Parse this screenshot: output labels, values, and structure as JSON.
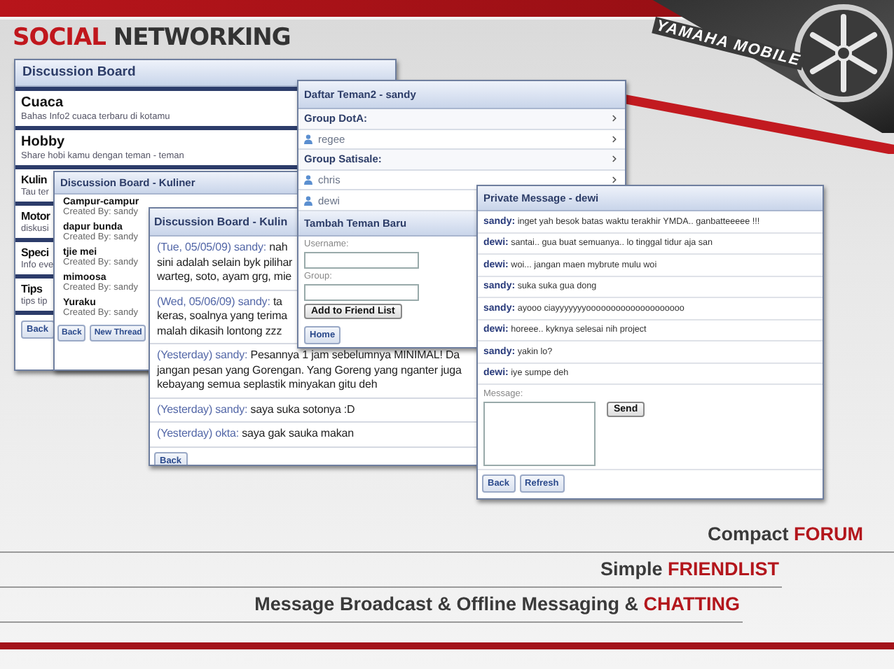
{
  "title": {
    "accent": "SOCIAL",
    "text": "NETWORKING"
  },
  "logo": {
    "text": "YAMAHA MOBILE"
  },
  "discussion_board": {
    "title": "Discussion Board",
    "topics": [
      {
        "name": "Cuaca",
        "description": "Bahas Info2 cuaca terbaru di kotamu"
      },
      {
        "name": "Hobby",
        "description": "Share hobi kamu dengan teman - teman"
      },
      {
        "name": "Kulin",
        "description": "Tau ter"
      },
      {
        "name": "Motor",
        "description": "diskusi"
      },
      {
        "name": "Speci",
        "description": "Info eve"
      },
      {
        "name": "Tips",
        "description": "tips tip"
      }
    ],
    "buttons": [
      "Back"
    ]
  },
  "kuliner_threads": {
    "title": "Discussion Board - Kuliner",
    "threads": [
      {
        "name": "Campur-campur",
        "creator": "Created By: sandy"
      },
      {
        "name": "dapur bunda",
        "creator": "Created By: sandy"
      },
      {
        "name": "tjie mei",
        "creator": "Created By: sandy"
      },
      {
        "name": "mimoosa",
        "creator": "Created By: sandy"
      },
      {
        "name": "Yuraku",
        "creator": "Created By: sandy"
      }
    ],
    "buttons": [
      "Back",
      "New Thread"
    ]
  },
  "kuliner_messages": {
    "title": "Discussion Board - Kulin",
    "messages": [
      {
        "meta": "(Tue, 05/05/09) sandy:",
        "lines": [
          "nah",
          "sini adalah selain byk pilihar",
          "warteg, soto, ayam grg, mie"
        ]
      },
      {
        "meta": "(Wed, 05/06/09) sandy:",
        "lines": [
          "ta",
          "keras, soalnya yang terima",
          "malah dikasih lontong zzz"
        ]
      },
      {
        "meta": "(Yesterday) sandy:",
        "lines": [
          "Pesannya 1 jam sebelumnya MINIMAL! Da",
          "jangan pesan yang Gorengan. Yang Goreng yang nganter juga",
          "kebayang semua seplastik minyakan gitu deh"
        ]
      },
      {
        "meta": "(Yesterday) sandy:",
        "lines": [
          "saya suka sotonya :D"
        ]
      },
      {
        "meta": "(Yesterday) okta:",
        "lines": [
          "saya gak sauka makan"
        ]
      }
    ],
    "buttons": [
      "Back"
    ]
  },
  "friend_list": {
    "title": "Daftar Teman2 - sandy",
    "items": [
      {
        "kind": "group",
        "label": "Group DotA:"
      },
      {
        "kind": "friend",
        "label": "regee"
      },
      {
        "kind": "group",
        "label": "Group Satisale:"
      },
      {
        "kind": "friend",
        "label": "chris"
      },
      {
        "kind": "friend",
        "label": "dewi"
      }
    ],
    "add_form": {
      "title": "Tambah Teman Baru",
      "fields": [
        {
          "label": "Username:"
        },
        {
          "label": "Group:"
        }
      ],
      "submit": "Add to Friend List",
      "home": "Home"
    }
  },
  "private_message": {
    "title": "Private Message - dewi",
    "messages": [
      {
        "sender": "sandy:",
        "text": "inget yah besok batas waktu terakhir YMDA.. ganbatteeeee !!!"
      },
      {
        "sender": "dewi:",
        "text": "santai.. gua buat semuanya.. lo tinggal tidur aja san"
      },
      {
        "sender": "dewi:",
        "text": "woi... jangan maen mybrute mulu woi"
      },
      {
        "sender": "sandy:",
        "text": "suka suka gua dong"
      },
      {
        "sender": "sandy:",
        "text": "ayooo ciayyyyyyyoooooooooooooooooooo"
      },
      {
        "sender": "dewi:",
        "text": "horeee.. kyknya selesai nih project"
      },
      {
        "sender": "sandy:",
        "text": "yakin lo?"
      },
      {
        "sender": "dewi:",
        "text": "iye sumpe deh"
      }
    ],
    "message_label": "Message:",
    "send": "Send",
    "buttons": [
      "Back",
      "Refresh"
    ]
  },
  "features": [
    {
      "text": "Compact",
      "accent": "FORUM"
    },
    {
      "text": "Simple",
      "accent": "FRIENDLIST"
    },
    {
      "text": "Message Broadcast & Offline Messaging &",
      "accent": "CHATTING"
    }
  ]
}
